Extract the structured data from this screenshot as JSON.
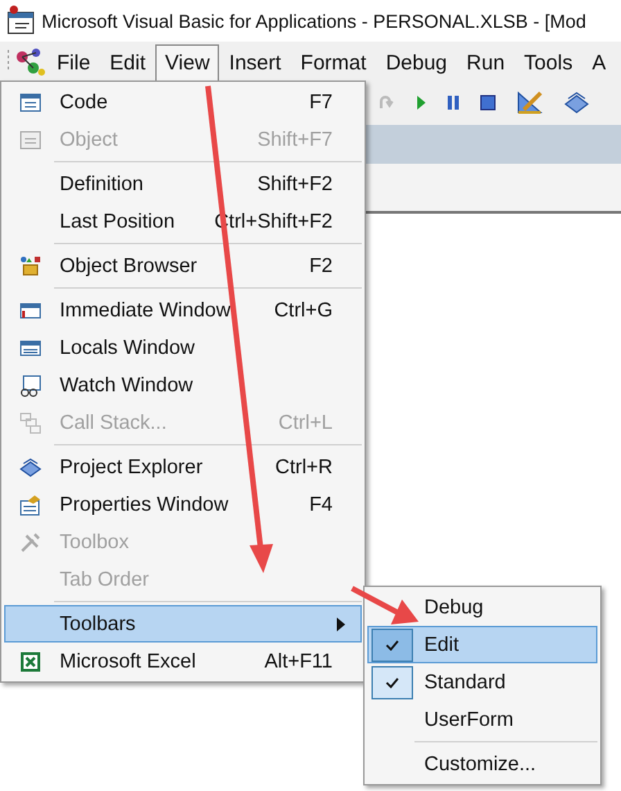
{
  "window": {
    "title": "Microsoft Visual Basic for Applications - PERSONAL.XLSB - [Mod"
  },
  "menu_bar": [
    {
      "label": "File",
      "selected": false
    },
    {
      "label": "Edit",
      "selected": false
    },
    {
      "label": "View",
      "selected": true
    },
    {
      "label": "Insert",
      "selected": false
    },
    {
      "label": "Format",
      "selected": false
    },
    {
      "label": "Debug",
      "selected": false
    },
    {
      "label": "Run",
      "selected": false
    },
    {
      "label": "Tools",
      "selected": false
    },
    {
      "label": "A",
      "selected": false
    }
  ],
  "view_menu": [
    {
      "kind": "item",
      "label": "Code",
      "shortcut": "F7",
      "disabled": false,
      "selected": false
    },
    {
      "kind": "item",
      "label": "Object",
      "shortcut": "Shift+F7",
      "disabled": true,
      "selected": false
    },
    {
      "kind": "separator"
    },
    {
      "kind": "item",
      "label": "Definition",
      "shortcut": "Shift+F2",
      "disabled": false,
      "selected": false
    },
    {
      "kind": "item",
      "label": "Last Position",
      "shortcut": "Ctrl+Shift+F2",
      "disabled": false,
      "selected": false
    },
    {
      "kind": "separator"
    },
    {
      "kind": "item",
      "label": "Object Browser",
      "shortcut": "F2",
      "disabled": false,
      "selected": false
    },
    {
      "kind": "separator"
    },
    {
      "kind": "item",
      "label": "Immediate Window",
      "shortcut": "Ctrl+G",
      "disabled": false,
      "selected": false
    },
    {
      "kind": "item",
      "label": "Locals Window",
      "disabled": false,
      "selected": false
    },
    {
      "kind": "item",
      "label": "Watch Window",
      "disabled": false,
      "selected": false
    },
    {
      "kind": "item",
      "label": "Call Stack...",
      "shortcut": "Ctrl+L",
      "disabled": true,
      "selected": false
    },
    {
      "kind": "separator"
    },
    {
      "kind": "item",
      "label": "Project Explorer",
      "shortcut": "Ctrl+R",
      "disabled": false,
      "selected": false
    },
    {
      "kind": "item",
      "label": "Properties Window",
      "shortcut": "F4",
      "disabled": false,
      "selected": false
    },
    {
      "kind": "item",
      "label": "Toolbox",
      "disabled": true,
      "selected": false
    },
    {
      "kind": "item",
      "label": "Tab Order",
      "disabled": true,
      "selected": false
    },
    {
      "kind": "separator"
    },
    {
      "kind": "submenu",
      "label": "Toolbars",
      "disabled": false,
      "selected": true
    },
    {
      "kind": "item",
      "label": "Microsoft Excel",
      "shortcut": "Alt+F11",
      "disabled": false,
      "selected": false
    }
  ],
  "toolbars_menu": [
    {
      "kind": "item",
      "label": "Debug",
      "checked": false,
      "selected": false
    },
    {
      "kind": "item",
      "label": "Edit",
      "checked": true,
      "selected": true
    },
    {
      "kind": "item",
      "label": "Standard",
      "checked": true,
      "selected": false
    },
    {
      "kind": "item",
      "label": "UserForm",
      "checked": false,
      "selected": false
    },
    {
      "kind": "separator"
    },
    {
      "kind": "item",
      "label": "Customize...",
      "checked": false,
      "selected": false
    }
  ]
}
